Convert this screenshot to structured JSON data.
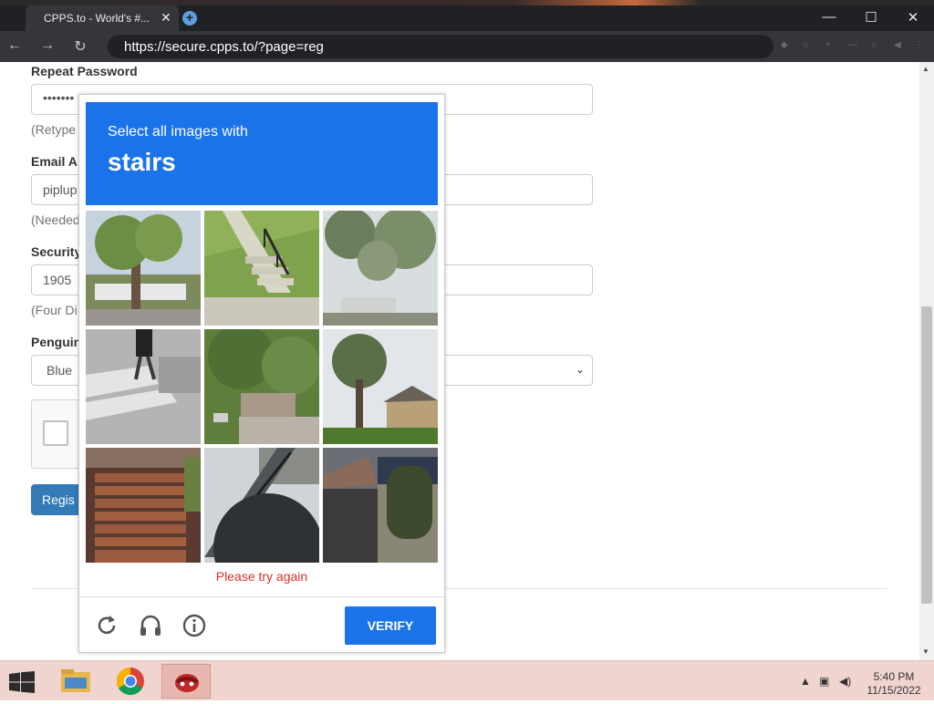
{
  "browser": {
    "tab_title": "CPPS.to - World's #...",
    "tab_close": "✕",
    "new_tab": "+",
    "url": "https://secure.cpps.to/?page=reg",
    "window_controls": {
      "minimize": "—",
      "maximize": "☐",
      "close": "✕"
    },
    "nav": {
      "back": "←",
      "forward": "→",
      "reload": "↻"
    }
  },
  "form": {
    "repeat_password_label": "Repeat Password",
    "repeat_password_value": "•••••••",
    "repeat_password_help": "(Retype",
    "email_label": "Email A",
    "email_value": "piplup",
    "email_help": "(Needed",
    "security_label": "Security",
    "security_value": "1905",
    "security_help": "(Four Di",
    "penguin_label": "Penguin",
    "penguin_value": "Blue",
    "register_button": "Regis"
  },
  "captcha": {
    "prompt": "Select all images with",
    "target": "stairs",
    "error": "Please try again",
    "verify_label": "VERIFY",
    "icons": [
      "reload-icon",
      "audio-challenge-icon",
      "info-icon"
    ],
    "accent_color": "#1a73e8",
    "error_color": "#d93025"
  },
  "taskbar": {
    "time": "5:40 PM",
    "date": "11/15/2022",
    "apps": [
      "file-explorer-icon",
      "chrome-icon",
      "app-icon"
    ]
  }
}
